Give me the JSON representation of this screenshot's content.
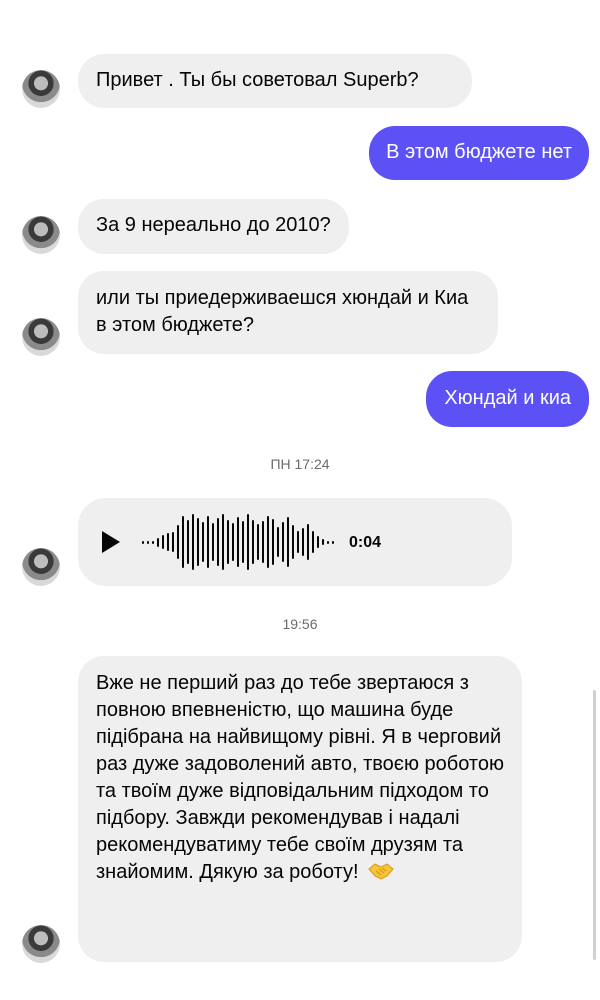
{
  "messages": [
    {
      "text": "Привет . Ты бы советовал Superb?"
    },
    {
      "text": "В этом бюджете нет"
    },
    {
      "text": "За 9 нереально до 2010?"
    },
    {
      "text": "или ты приедерживаешся хюндай и Киа в этом бюджете?"
    },
    {
      "text": "Хюндай и киа"
    }
  ],
  "timestamp_1": "ПН 17:24",
  "voice": {
    "duration": "0:04",
    "icon": "play-icon"
  },
  "timestamp_2": "19:56",
  "long_message": "Вже не перший раз до тебе звертаюся з повною впевненістю, що машина буде підібрана на найвищому рівні. Я в черговий раз дуже задоволений авто, твоєю роботою та твоїм дуже відповідальним підходом то підбору. Завжди рекомендував і надалі рекомендуватиму тебе своїм друзям та знайомим. Дякую за роботу!",
  "colors": {
    "outgoing": "#5b51f5",
    "incoming": "#efefef"
  },
  "icons": [
    "avatar",
    "play-icon",
    "handshake-icon"
  ]
}
